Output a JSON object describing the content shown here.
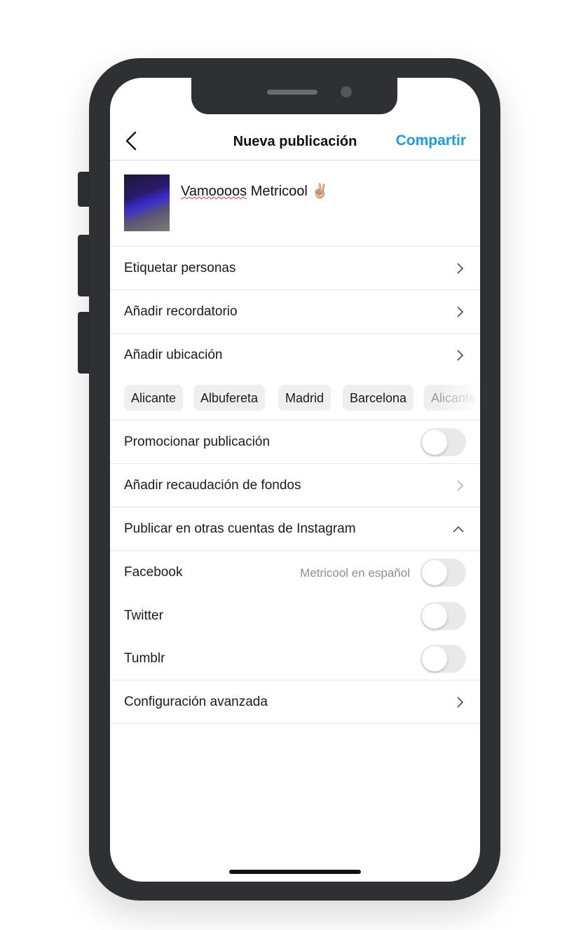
{
  "header": {
    "title": "Nueva publicación",
    "share_label": "Compartir",
    "back_icon": "chevron-left-icon"
  },
  "caption": {
    "misspelled": "Vamoooos",
    "rest": " Metricool",
    "emoji": "✌🏼"
  },
  "rows": {
    "tag": "Etiquetar personas",
    "reminder": "Añadir recordatorio",
    "location": "Añadir ubicación",
    "promote": "Promocionar publicación",
    "fundraiser": "Añadir recaudación de fondos",
    "other_accounts": "Publicar en otras cuentas de Instagram",
    "facebook": "Facebook",
    "facebook_account": "Metricool en español",
    "twitter": "Twitter",
    "tumblr": "Tumblr",
    "advanced": "Configuración avanzada"
  },
  "location_chips": [
    "Alicante",
    "Albufereta",
    "Madrid",
    "Barcelona",
    "Alicante"
  ],
  "toggles": {
    "promote": false,
    "facebook": false,
    "twitter": false,
    "tumblr": false
  },
  "colors": {
    "accent": "#1a9de6",
    "phone": "#2f3033"
  }
}
